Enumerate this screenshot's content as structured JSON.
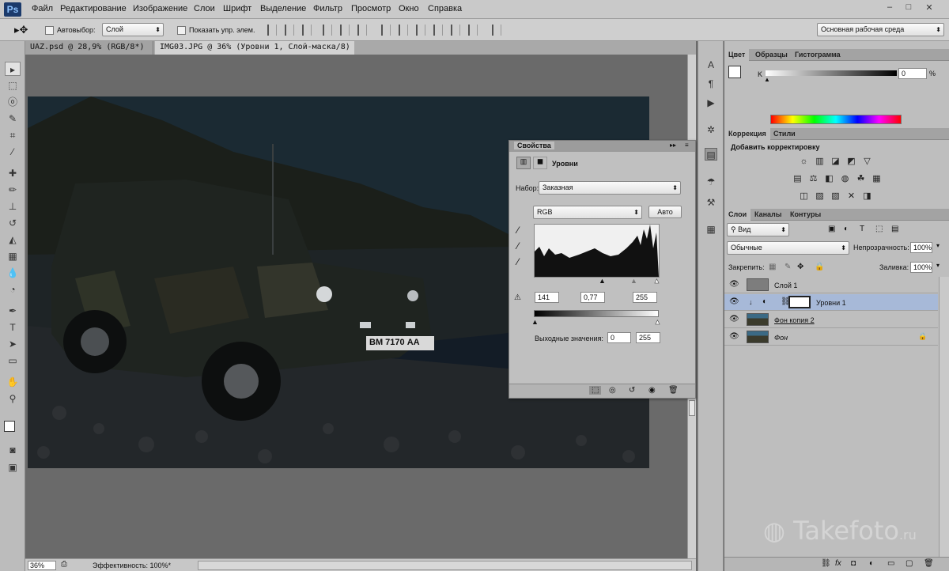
{
  "app": {
    "logo": "Ps"
  },
  "menu": [
    "Файл",
    "Редактирование",
    "Изображение",
    "Слои",
    "Шрифт",
    "Выделение",
    "Фильтр",
    "Просмотр",
    "Окно",
    "Справка"
  ],
  "window_controls": [
    "–",
    "□",
    "✕"
  ],
  "options": {
    "autoselect_label": "Автовыбор:",
    "autoselect_value": "Слой",
    "show_transform_label": "Показать упр. элем.",
    "workspace": "Основная рабочая среда"
  },
  "doc_tabs": [
    {
      "label": "UAZ.psd @ 28,9% (RGB/8*) *",
      "close": "×"
    },
    {
      "label": "IMG03.JPG @ 36% (Уровни 1, Слой-маска/8) *",
      "close": "×"
    }
  ],
  "status": {
    "zoom": "36%",
    "efficiency": "Эффективность: 100%*"
  },
  "photo": {
    "plate": "ВМ 7170 АА"
  },
  "color_panel": {
    "tabs": [
      "Цвет",
      "Образцы",
      "Гистограмма"
    ],
    "channel": "K",
    "value": "0",
    "unit": "%"
  },
  "adjust_panel": {
    "tabs": [
      "Коррекция",
      "Стили"
    ],
    "title": "Добавить корректировку",
    "row1": [
      "☼",
      "▥",
      "◪",
      "◩",
      "▽"
    ],
    "row2": [
      "▤",
      "⚖",
      "◧",
      "◍",
      "☘",
      "▦"
    ],
    "row3": [
      "◫",
      "▨",
      "▧",
      "✕",
      "◨"
    ]
  },
  "layers_panel": {
    "tabs": [
      "Слои",
      "Каналы",
      "Контуры"
    ],
    "filter": "Вид",
    "blend": "Обычные",
    "opacity_label": "Непрозрачность:",
    "opacity": "100%",
    "lock_label": "Закрепить:",
    "fill_label": "Заливка:",
    "fill": "100%",
    "layers": [
      {
        "name": "Слой 1"
      },
      {
        "name": "Уровни 1"
      },
      {
        "name": "Фон копия 2"
      },
      {
        "name": "Фон"
      }
    ],
    "footer_icons": [
      "⛓",
      "fx",
      "◘",
      "◐",
      "▭",
      "▢",
      "🗑"
    ]
  },
  "properties": {
    "title": "Свойства",
    "heading": "Уровни",
    "preset_label": "Набор:",
    "preset": "Заказная",
    "channel": "RGB",
    "auto": "Авто",
    "input_black": "141",
    "input_gamma": "0,77",
    "input_white": "255",
    "output_label": "Выходные значения:",
    "output_black": "0",
    "output_white": "255"
  },
  "watermark": {
    "brand": "Takefoto",
    "suffix": ".ru"
  },
  "colors": {
    "accent_selected_layer": "#a7b9d8",
    "panel": "#bebebe"
  }
}
